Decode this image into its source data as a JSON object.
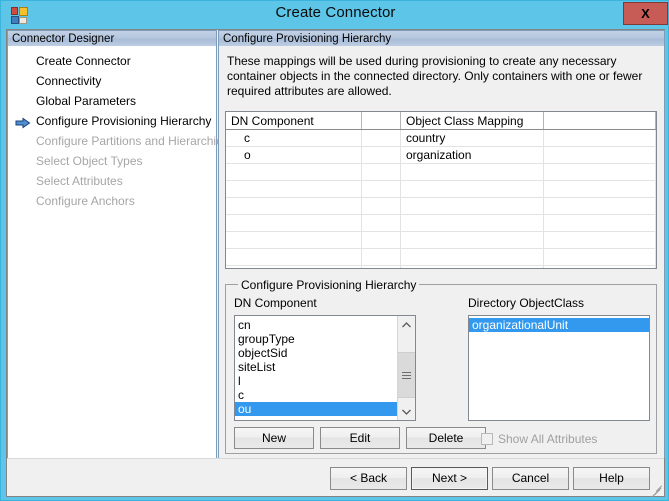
{
  "window": {
    "title": "Create Connector",
    "close_label": "X",
    "icon": "connector-app-icon"
  },
  "sidebar": {
    "header": "Connector Designer",
    "items": [
      {
        "label": "Create Connector",
        "enabled": true,
        "current": false
      },
      {
        "label": "Connectivity",
        "enabled": true,
        "current": false
      },
      {
        "label": "Global Parameters",
        "enabled": true,
        "current": false
      },
      {
        "label": "Configure Provisioning Hierarchy",
        "enabled": true,
        "current": true
      },
      {
        "label": "Configure Partitions and Hierarchies",
        "enabled": false,
        "current": false
      },
      {
        "label": "Select Object Types",
        "enabled": false,
        "current": false
      },
      {
        "label": "Select Attributes",
        "enabled": false,
        "current": false
      },
      {
        "label": "Configure Anchors",
        "enabled": false,
        "current": false
      }
    ]
  },
  "main": {
    "header": "Configure Provisioning Hierarchy",
    "description": "These mappings will be used during provisioning to create any necessary container objects in the connected directory.  Only containers with one or fewer required attributes are allowed.",
    "grid": {
      "columns": [
        "DN Component",
        "",
        "Object Class Mapping",
        ""
      ],
      "rows": [
        [
          "c",
          "",
          "country",
          ""
        ],
        [
          "o",
          "",
          "organization",
          ""
        ]
      ],
      "empty_row_count": 7
    },
    "groupbox": {
      "legend": "Configure Provisioning Hierarchy",
      "dn_label": "DN Component",
      "objectclass_label": "Directory ObjectClass",
      "dn_items": [
        {
          "label": "cn",
          "selected": false
        },
        {
          "label": "groupType",
          "selected": false
        },
        {
          "label": "objectSid",
          "selected": false
        },
        {
          "label": "siteList",
          "selected": false
        },
        {
          "label": "l",
          "selected": false
        },
        {
          "label": "c",
          "selected": false
        },
        {
          "label": "ou",
          "selected": true
        }
      ],
      "objectclass_items": [
        {
          "label": "organizationalUnit",
          "selected": true
        }
      ],
      "buttons": {
        "new": "New",
        "edit": "Edit",
        "delete": "Delete"
      },
      "checkbox": {
        "label": "Show All Attributes",
        "checked": false,
        "enabled": false
      }
    }
  },
  "footer": {
    "back": "< Back",
    "next": "Next  >",
    "cancel": "Cancel",
    "help": "Help"
  },
  "colors": {
    "titlebar": "#5cc5e8",
    "close_button": "#c75b56",
    "selection": "#3399ee",
    "panel_header": "#b4c6de",
    "dialog_face": "#f0f0f0"
  }
}
